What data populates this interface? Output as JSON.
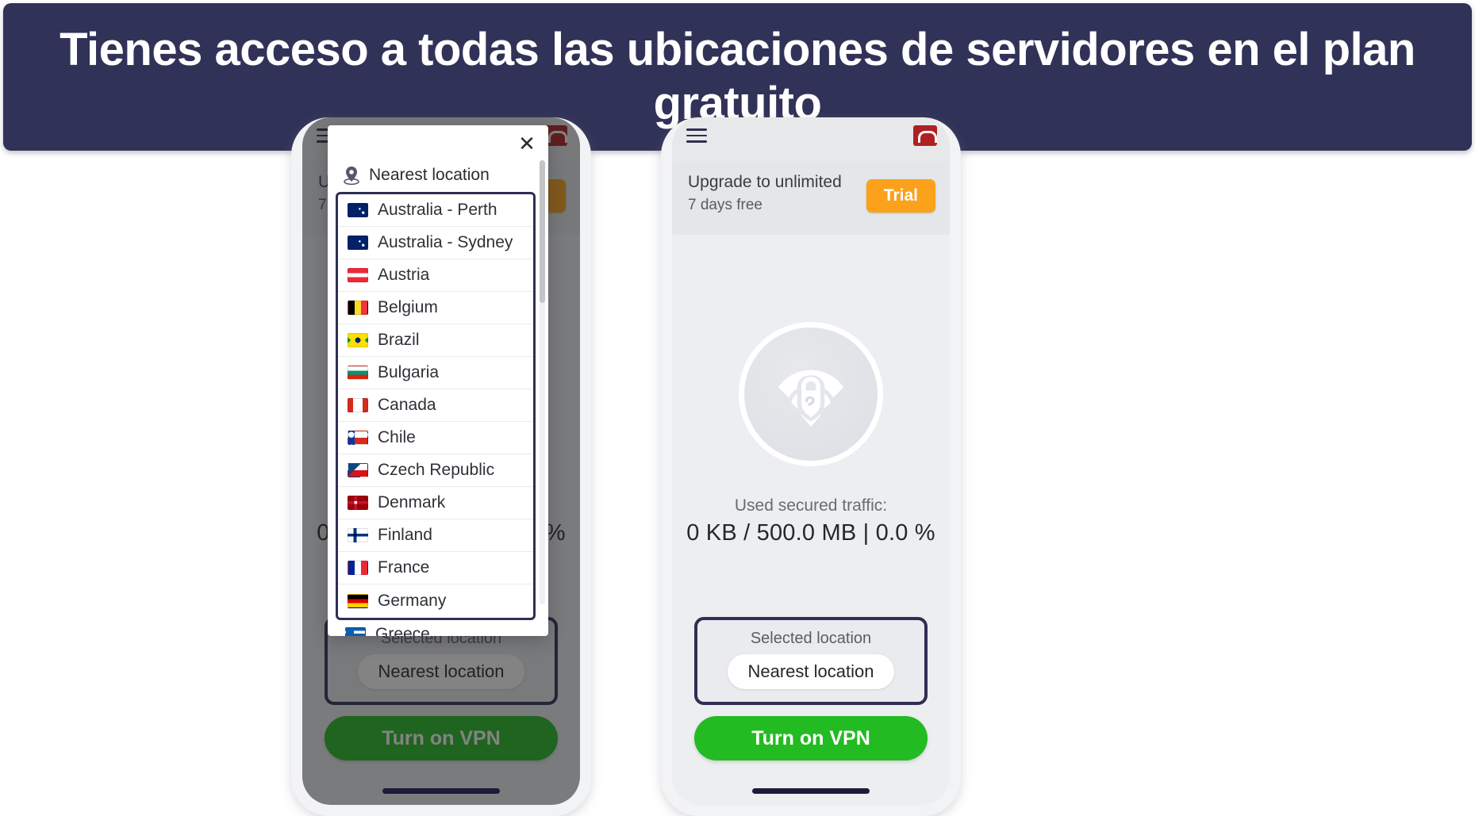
{
  "banner": {
    "text": "Tienes acceso a todas las ubicaciones de servidores en el plan gratuito",
    "bg_color": "#313258",
    "text_color": "#ffffff"
  },
  "colors": {
    "navy": "#2e2f52",
    "trial_orange": "#fba21a",
    "vpn_green": "#22bb22",
    "screen_bg": "#eceef0"
  },
  "app": {
    "menu_icon": "hamburger-icon",
    "brand_icon": "avira-logo-icon",
    "upsell": {
      "title": "Upgrade to unlimited",
      "subtitle": "7 days free",
      "badge": "Trial"
    },
    "logo_icon": "vpn-shield-wifi-lock-icon",
    "traffic": {
      "label": "Used secured traffic:",
      "value": "0 KB / 500.0 MB  |  0.0 %",
      "used": "0 KB",
      "quota": "500.0 MB",
      "percent": "0.0 %"
    },
    "selected_location": {
      "label": "Selected location",
      "value": "Nearest location"
    },
    "vpn_button": "Turn on VPN"
  },
  "left_phone": {
    "dimmed_title_fragment": "U",
    "dimmed_sub_fragment": "7"
  },
  "location_dialog": {
    "close_icon": "close-icon",
    "pin_icon": "location-pin-icon",
    "header": "Nearest location",
    "items": [
      {
        "name": "Australia - Perth",
        "flag": "au"
      },
      {
        "name": "Australia - Sydney",
        "flag": "au"
      },
      {
        "name": "Austria",
        "flag": "at"
      },
      {
        "name": "Belgium",
        "flag": "be"
      },
      {
        "name": "Brazil",
        "flag": "br"
      },
      {
        "name": "Bulgaria",
        "flag": "bg"
      },
      {
        "name": "Canada",
        "flag": "ca"
      },
      {
        "name": "Chile",
        "flag": "cl"
      },
      {
        "name": "Czech Republic",
        "flag": "cz"
      },
      {
        "name": "Denmark",
        "flag": "dk"
      },
      {
        "name": "Finland",
        "flag": "fi"
      },
      {
        "name": "France",
        "flag": "fr"
      },
      {
        "name": "Germany",
        "flag": "de"
      }
    ],
    "partial_item": {
      "name": "Greece",
      "flag": "gr"
    }
  }
}
